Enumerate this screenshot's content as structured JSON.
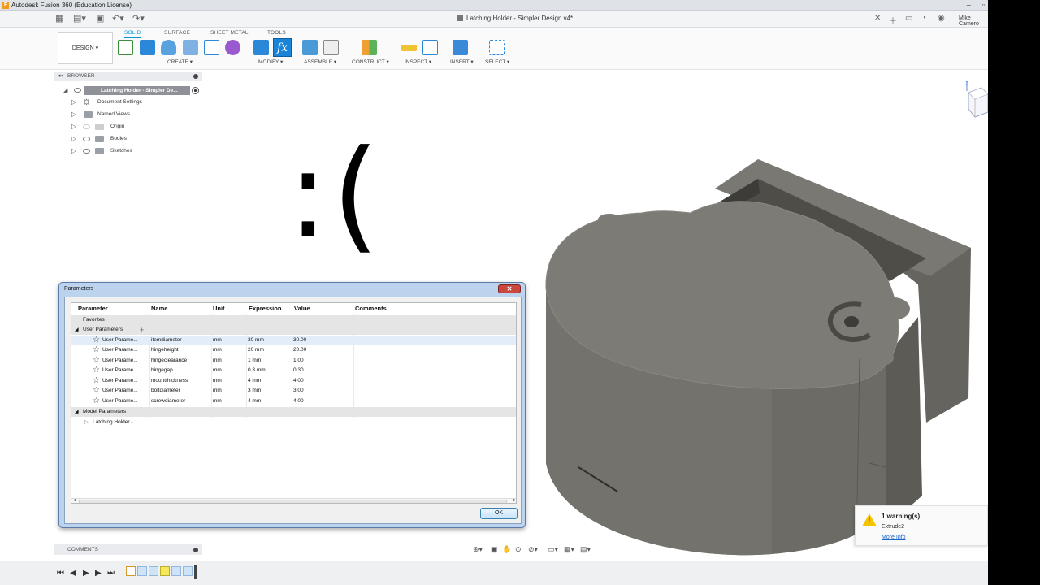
{
  "titlebar": {
    "app_title": "Autodesk Fusion 360 (Education License)",
    "app_icon": "F"
  },
  "document_tab": {
    "title": "Latching Holder - Simpler Design v4*"
  },
  "user": {
    "name": "Mike Camero"
  },
  "ribbon": {
    "workspace": "DESIGN ▾",
    "tabs": [
      "SOLID",
      "SURFACE",
      "SHEET METAL",
      "TOOLS"
    ],
    "active_tab": "SOLID",
    "groups": [
      "CREATE ▾",
      "MODIFY ▾",
      "ASSEMBLE ▾",
      "CONSTRUCT ▾",
      "INSPECT ▾",
      "INSERT ▾",
      "SELECT ▾"
    ],
    "fx_label": "fx"
  },
  "browser": {
    "header": "BROWSER",
    "root": "Latching Holder - Simpler De...",
    "items": [
      "Document Settings",
      "Named Views",
      "Origin",
      "Bodies",
      "Sketches"
    ]
  },
  "overlay": {
    "sad_face": ":("
  },
  "parameters_dialog": {
    "title": "Parameters",
    "columns": [
      "Parameter",
      "Name",
      "Unit",
      "Expression",
      "Value",
      "Comments"
    ],
    "sections": {
      "favorites": "Favorites",
      "user": "User Parameters",
      "model": "Model Parameters"
    },
    "user_rows": [
      {
        "parameter": "User Parame...",
        "name": "itemdiameter",
        "unit": "mm",
        "expression": "30 mm",
        "value": "30.00",
        "comments": ""
      },
      {
        "parameter": "User Parame...",
        "name": "hingeheight",
        "unit": "mm",
        "expression": "20 mm",
        "value": "20.00",
        "comments": ""
      },
      {
        "parameter": "User Parame...",
        "name": "hingeclearance",
        "unit": "mm",
        "expression": "1 mm",
        "value": "1.00",
        "comments": ""
      },
      {
        "parameter": "User Parame...",
        "name": "hingegap",
        "unit": "mm",
        "expression": "0.3 mm",
        "value": "0.30",
        "comments": ""
      },
      {
        "parameter": "User Parame...",
        "name": "mountthickness",
        "unit": "mm",
        "expression": "4 mm",
        "value": "4.00",
        "comments": ""
      },
      {
        "parameter": "User Parame...",
        "name": "boltdiameter",
        "unit": "mm",
        "expression": "3 mm",
        "value": "3.00",
        "comments": ""
      },
      {
        "parameter": "User Parame...",
        "name": "screwdiameter",
        "unit": "mm",
        "expression": "4 mm",
        "value": "4.00",
        "comments": ""
      }
    ],
    "model_row": "Latching Holder - ...",
    "add_symbol": "+",
    "ok_label": "OK"
  },
  "warning": {
    "title": "1 warning(s)",
    "detail": "Extrude2",
    "link": "More Info"
  },
  "comments_panel": {
    "header": "COMMENTS"
  },
  "colors": {
    "accent": "#0696d7",
    "model_gray": "#6f6d67",
    "warning_yellow": "#f5c400"
  }
}
